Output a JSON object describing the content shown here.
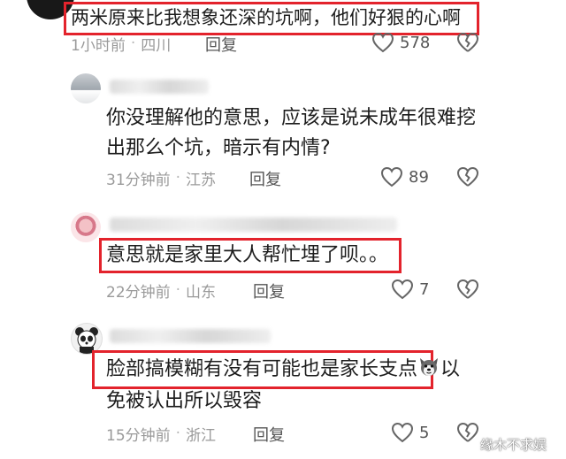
{
  "comments": [
    {
      "text": "两米原来比我想象还深的坑啊，他们好狠的心啊",
      "time": "1小时前",
      "location": "四川",
      "reply_label": "回复",
      "likes": "578"
    },
    {
      "text_line1": "你没理解他的意思，应该是说未成年很难挖",
      "text_line2": "出那么个坑，暗示有内情?",
      "time": "31分钟前",
      "location": "江苏",
      "reply_label": "回复",
      "likes": "89"
    },
    {
      "text": "意思就是家里大人帮忙埋了呗。。",
      "time": "22分钟前",
      "location": "山东",
      "reply_label": "回复",
      "likes": "7"
    },
    {
      "text_line1_a": "脸部搞模糊有没有可能也是家长支点",
      "text_line1_b": "以",
      "text_line2": "免被认出所以毁容",
      "time": "15分钟前",
      "location": "浙江",
      "reply_label": "回复",
      "likes": "5"
    }
  ],
  "separator": "·",
  "watermark": "缘木不求娱",
  "colors": {
    "highlight": "#e3232c",
    "meta": "#9a9a9a"
  },
  "icons": [
    "heart-icon",
    "broken-heart-icon",
    "dog-emoji-icon"
  ]
}
